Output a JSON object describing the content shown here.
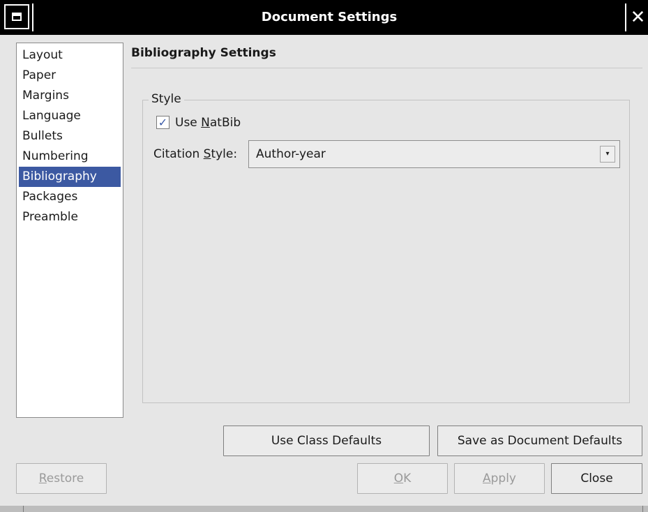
{
  "window": {
    "title": "Document Settings",
    "menu_icon": "window-menu-icon",
    "close_icon": "close-icon",
    "close_glyph": "✕"
  },
  "sidebar": {
    "items": [
      {
        "label": "Layout"
      },
      {
        "label": "Paper"
      },
      {
        "label": "Margins"
      },
      {
        "label": "Language"
      },
      {
        "label": "Bullets"
      },
      {
        "label": "Numbering"
      },
      {
        "label": "Bibliography",
        "selected": true
      },
      {
        "label": "Packages"
      },
      {
        "label": "Preamble"
      }
    ]
  },
  "panel": {
    "title": "Bibliography Settings",
    "group_label": "Style",
    "use_natbib": {
      "label_pre": "Use ",
      "mnemonic": "N",
      "label_post": "atBib",
      "checked": true,
      "check_glyph": "✓"
    },
    "citation_style": {
      "label_pre": "Citation ",
      "mnemonic": "S",
      "label_post": "tyle:",
      "value": "Author-year",
      "dropdown_glyph": "▾"
    }
  },
  "buttons": {
    "use_class_defaults": "Use Class Defaults",
    "save_as_document_defaults": "Save as Document Defaults",
    "restore": {
      "mnemonic": "R",
      "rest": "estore"
    },
    "ok": {
      "mnemonic": "O",
      "rest": "K"
    },
    "apply": {
      "mnemonic": "A",
      "rest": "pply"
    },
    "close": "Close"
  },
  "colors": {
    "selection": "#3c59a2",
    "background": "#e6e6e6",
    "titlebar": "#000000"
  }
}
